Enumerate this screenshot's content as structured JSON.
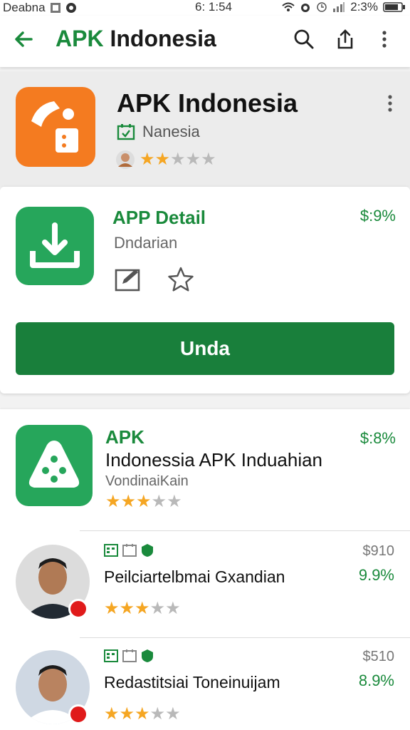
{
  "status_bar": {
    "carrier": "Deabna",
    "time": "6: 1:54",
    "battery": "2:3%"
  },
  "app_bar": {
    "title_green": "APK",
    "title_rest": " Indonesia"
  },
  "hero": {
    "name": "APK Indonesia",
    "developer": "Nanesia",
    "rating": 1.5
  },
  "detail_card": {
    "heading": "APP Detail",
    "subtitle": "Dndarian",
    "price": "$:9%",
    "button_label": "Unda"
  },
  "listing": {
    "heading": "APK",
    "title": "Indonessia APK Induahian",
    "subtitle": "VondinaiKain",
    "price": "$:8%",
    "rating": 2.5
  },
  "rows": [
    {
      "name": "Peilciartelbmai Gxandian",
      "price_top": "$910",
      "price_bottom": "9.9%",
      "rating": 3
    },
    {
      "name": "Redastitsiai Toneinuijam",
      "price_top": "$510",
      "price_bottom": "8.9%",
      "rating": 3
    }
  ],
  "colors": {
    "accent": "#1a8a3c",
    "button": "#197f3b",
    "orange": "#f47b20",
    "green_icon": "#26a65b",
    "star": "#f5a623",
    "alert_dot": "#e01a1a"
  },
  "icons": [
    "back-arrow-icon",
    "search-icon",
    "share-icon",
    "more-vert-icon",
    "download-icon",
    "edit-icon",
    "star-outline-icon",
    "calendar-badge-icon",
    "shield-icon"
  ]
}
